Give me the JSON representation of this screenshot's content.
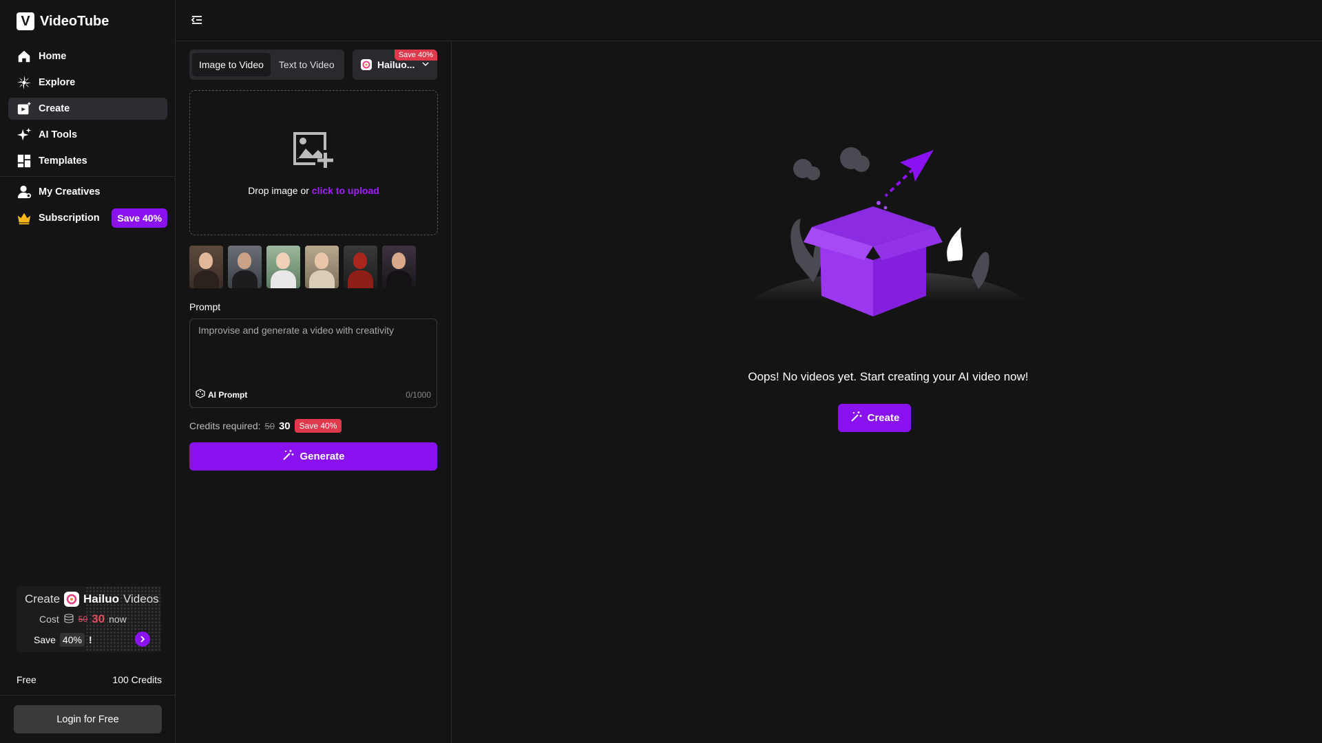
{
  "brand": {
    "logo_letter": "V",
    "name": "VideoTube"
  },
  "nav": {
    "items": [
      {
        "label": "Home",
        "icon": "home-icon"
      },
      {
        "label": "Explore",
        "icon": "explore-icon"
      },
      {
        "label": "Create",
        "icon": "create-icon",
        "active": true
      },
      {
        "label": "AI Tools",
        "icon": "sparkle-icon"
      },
      {
        "label": "Templates",
        "icon": "templates-icon"
      }
    ],
    "secondary": [
      {
        "label": "My Creatives",
        "icon": "user-icon"
      },
      {
        "label": "Subscription",
        "icon": "crown-icon",
        "badge": "Save 40%"
      }
    ]
  },
  "promo": {
    "create": "Create",
    "model": "Hailuo",
    "videos": "Videos",
    "cost_label": "Cost",
    "old_cost": "50",
    "new_cost": "30",
    "now": "now",
    "save": "Save",
    "percent": "40%",
    "exclaim": "!"
  },
  "plan": {
    "name": "Free",
    "credits": "100 Credits"
  },
  "login_button": "Login for Free",
  "panel": {
    "tabs": [
      {
        "label": "Image to Video",
        "active": true
      },
      {
        "label": "Text to Video",
        "active": false
      }
    ],
    "model": {
      "label": "Hailuo...",
      "badge": "Save 40%"
    },
    "dropzone": {
      "text": "Drop image or ",
      "link": "click to upload"
    },
    "prompt": {
      "label": "Prompt",
      "placeholder": "Improvise and generate a video with creativity",
      "ai_prompt": "AI Prompt",
      "count": "0/1000"
    },
    "credits": {
      "label": "Credits required:",
      "old": "50",
      "new": "30",
      "badge": "Save 40%"
    },
    "generate": "Generate"
  },
  "main": {
    "empty_text": "Oops! No videos yet. Start creating your AI video now!",
    "create_button": "Create"
  },
  "colors": {
    "accent": "#8b12f0",
    "danger": "#e0394c",
    "bg": "#141414",
    "link": "#a31dff"
  }
}
